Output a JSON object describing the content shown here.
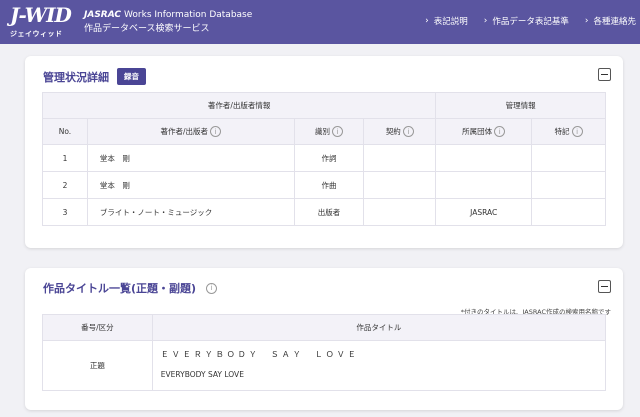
{
  "header": {
    "logo_main": "J-WID",
    "logo_sub": "ジェイウィッド",
    "brand_org": "JASRAC",
    "brand_name": "Works Information Database",
    "brand_jp": "作品データベース検索サービス",
    "nav": [
      "表記説明",
      "作品データ表記基準",
      "各種連絡先"
    ]
  },
  "management": {
    "title": "管理状況詳細",
    "badge": "録音",
    "group_headers": [
      "著作者/出版者情報",
      "管理情報"
    ],
    "columns": [
      "No.",
      "著作者/出版者",
      "識別",
      "契約",
      "所属団体",
      "特記"
    ],
    "rows": [
      {
        "no": "1",
        "name": "堂本　剛",
        "role": "作詞",
        "contract": "",
        "society": "",
        "note": ""
      },
      {
        "no": "2",
        "name": "堂本　剛",
        "role": "作曲",
        "contract": "",
        "society": "",
        "note": ""
      },
      {
        "no": "3",
        "name": "ブライト・ノート・ミュージック",
        "role": "出版者",
        "contract": "",
        "society": "JASRAC",
        "note": ""
      }
    ]
  },
  "titles": {
    "title": "作品タイトル一覧(正題・副題)",
    "note": "*付きのタイトルは、JASRAC作成の検索用名称です",
    "columns": [
      "番号/区分",
      "作品タイトル"
    ],
    "rows": [
      {
        "kind": "正題",
        "title_spaced": "ＥＶＥＲＹＢＯＤＹ　ＳＡＹ　ＬＯＶＥ",
        "title_plain": "EVERYBODY SAY LOVE"
      }
    ]
  },
  "icons": {
    "info": "info-icon",
    "collapse": "minus-square-icon",
    "nav_arrow": "chevron-right-icon"
  },
  "colors": {
    "header_bg": "#5a55a0",
    "accent": "#4a4595"
  }
}
